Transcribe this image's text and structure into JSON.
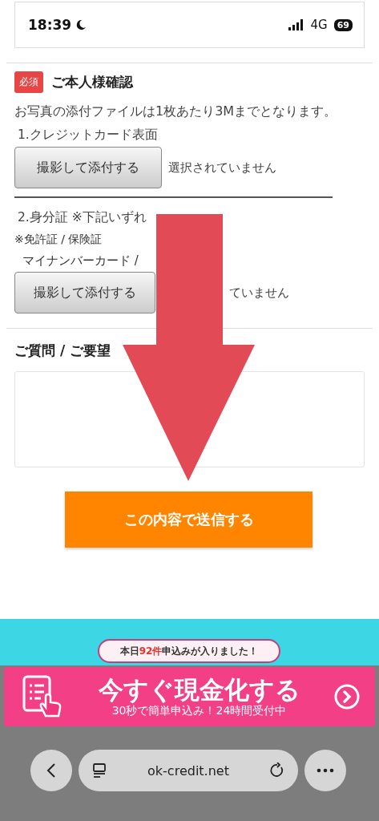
{
  "status_bar": {
    "time": "18:39",
    "network": "4G",
    "battery": "69"
  },
  "identity": {
    "badge": "必須",
    "title": "ご本人様確認",
    "note": "お写真の添付ファイルは1枚あたり3Mまでとなります。",
    "items": [
      {
        "label": "1.クレジットカード表面",
        "button": "撮影して添付する",
        "status": "選択されていません"
      },
      {
        "label": "2.身分証 ※下記いずれ",
        "sublines": [
          "※免許証 / 保険証",
          "マイナンバーカード /"
        ],
        "button": "撮影して添付する",
        "status": "ていません"
      }
    ]
  },
  "inquiry": {
    "title": "ご質問 / ご要望"
  },
  "submit": "この内容で送信する",
  "banner": {
    "bubble": "本日**92件**申込みが入りました！",
    "title": "今すぐ現金化する",
    "subtitle": "30秒で簡単申込み！24時間受付中"
  },
  "browser": {
    "url": "ok-credit.net"
  }
}
